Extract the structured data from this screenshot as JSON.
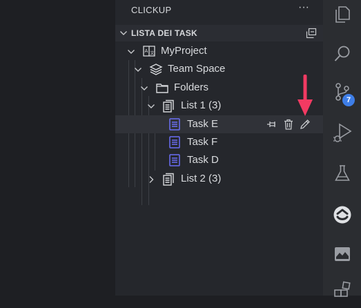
{
  "panel": {
    "title": "CLICKUP",
    "more_label": "···"
  },
  "section": {
    "title": "LISTA DEI TASK"
  },
  "tree": {
    "project": "MyProject",
    "space": "Team Space",
    "folder": "Folders",
    "list1": "List 1 (3)",
    "tasks": [
      "Task E",
      "Task F",
      "Task D"
    ],
    "list2": "List 2 (3)"
  },
  "activity_bar": {
    "scm_badge": "7"
  },
  "icons": {
    "explorer": "files-icon",
    "search": "search-icon",
    "scm": "source-control-icon",
    "debug": "run-debug-icon",
    "testing": "flask-icon",
    "clickup": "clickup-icon",
    "image": "image-preview-icon",
    "extensions": "extensions-icon"
  },
  "colors": {
    "accent_arrow": "#f23a62",
    "badge": "#3e7ee8",
    "task_icon": "#6b6ff5"
  }
}
